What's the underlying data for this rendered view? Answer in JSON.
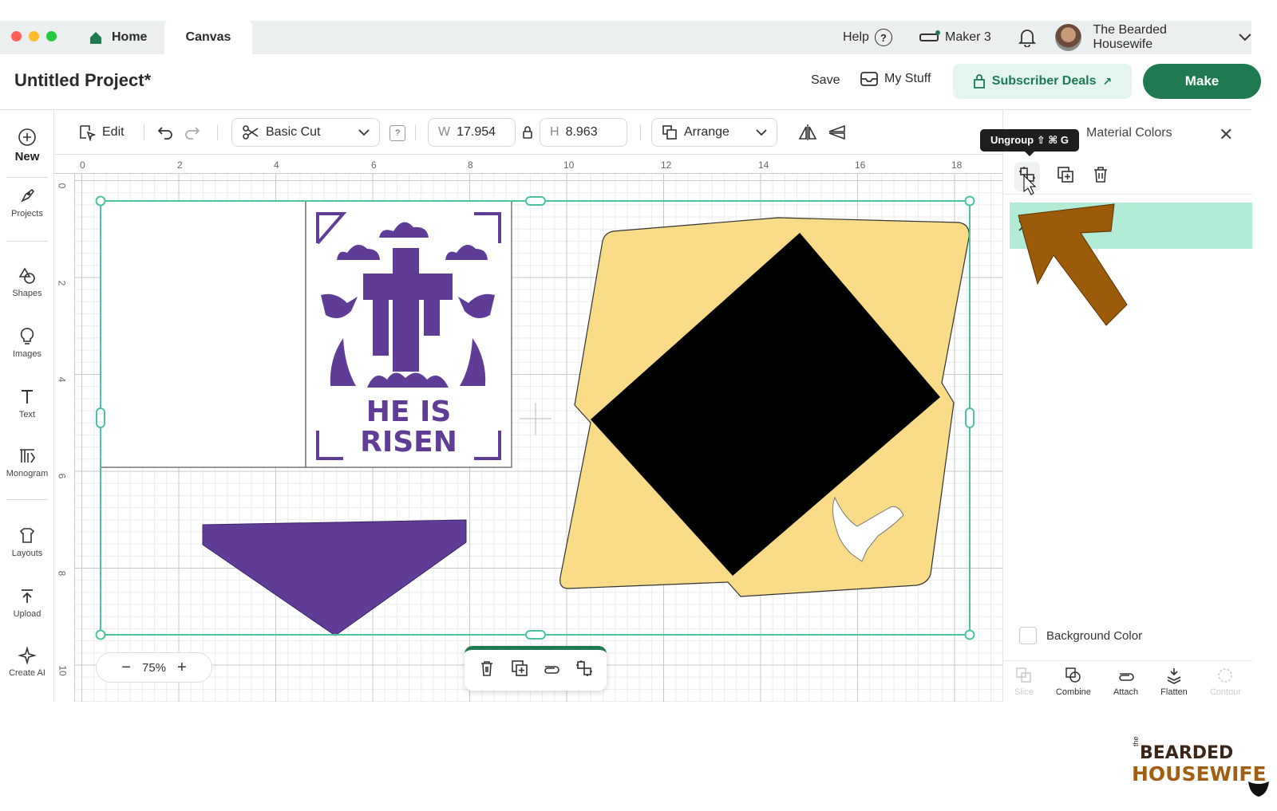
{
  "tabs": {
    "home_label": "Home",
    "canvas_label": "Canvas"
  },
  "top_right": {
    "help_label": "Help",
    "help_glyph": "?",
    "machine_label": "Maker 3",
    "user_name": "The Bearded Housewife"
  },
  "header": {
    "project_title": "Untitled Project*",
    "save_label": "Save",
    "mystuff_label": "My Stuff",
    "deals_label": "Subscriber Deals",
    "deals_arrow": "↗",
    "make_label": "Make"
  },
  "sidebar": {
    "items": [
      {
        "label": "New",
        "icon": "plus-circle-icon"
      },
      {
        "label": "Projects",
        "icon": "projects-icon"
      },
      {
        "label": "Shapes",
        "icon": "shapes-icon"
      },
      {
        "label": "Images",
        "icon": "lightbulb-icon"
      },
      {
        "label": "Text",
        "icon": "text-icon"
      },
      {
        "label": "Monogram",
        "icon": "monogram-icon"
      },
      {
        "label": "Layouts",
        "icon": "layouts-icon"
      },
      {
        "label": "Upload",
        "icon": "upload-icon"
      },
      {
        "label": "Create AI",
        "icon": "sparkle-icon"
      }
    ]
  },
  "toolbar": {
    "edit_label": "Edit",
    "operation_value": "Basic Cut",
    "help_glyph": "?",
    "width_label": "W",
    "width_value": "17.954",
    "height_label": "H",
    "height_value": "8.963",
    "arrange_label": "Arrange"
  },
  "ruler": {
    "top_numbers": [
      "0",
      "2",
      "4",
      "6",
      "8",
      "10",
      "12",
      "14",
      "16",
      "18"
    ],
    "left_numbers": [
      "0",
      "2",
      "4",
      "6",
      "8",
      "10"
    ]
  },
  "canvas": {
    "design_text_line1": "HE IS",
    "design_text_line2": "RISEN",
    "colors": {
      "purple": "#5f3c96",
      "envelope": "#f9db88",
      "black": "#000000",
      "selection": "#4bc3a0"
    },
    "zoom_value": "75%",
    "zoom_minus": "−",
    "zoom_plus": "+"
  },
  "right_panel": {
    "title": "Material Colors",
    "tooltip": "Ungroup ⇧ ⌘ G",
    "background_color_label": "Background Color",
    "bottom_tools": [
      {
        "label": "Slice",
        "enabled": false
      },
      {
        "label": "Combine",
        "enabled": true
      },
      {
        "label": "Attach",
        "enabled": true
      },
      {
        "label": "Flatten",
        "enabled": true
      },
      {
        "label": "Contour",
        "enabled": false
      }
    ]
  },
  "watermark": {
    "prefix": "the",
    "line1": "BEARDED",
    "line2": "HOUSEWIFE"
  },
  "accent_colors": {
    "brand_green": "#1f7a52",
    "arrow_brown": "#9b5b08",
    "layer_highlight": "#b2ecd6"
  }
}
